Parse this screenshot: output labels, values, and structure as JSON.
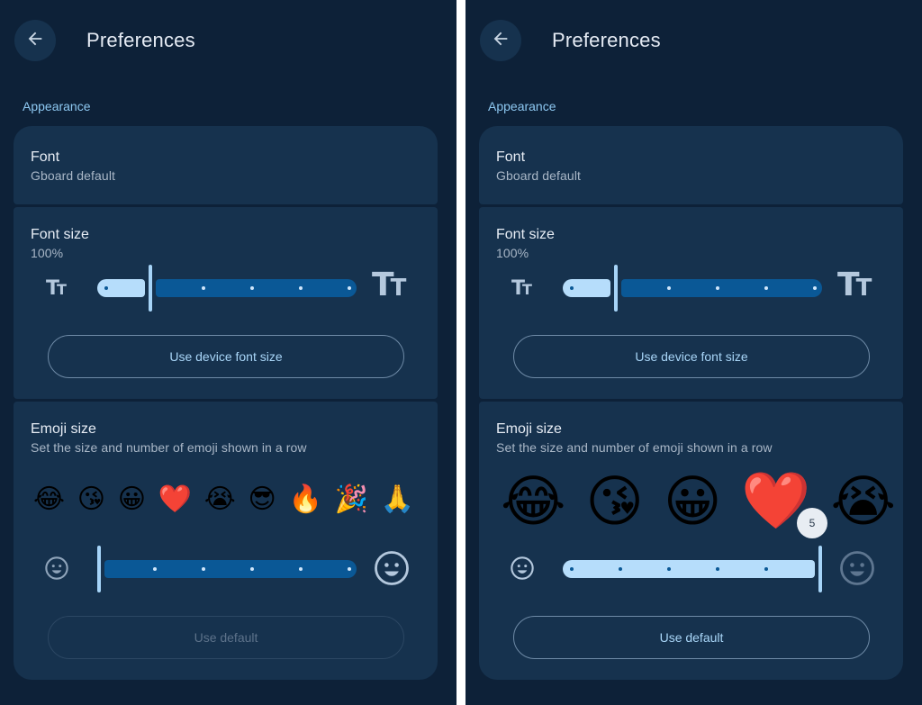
{
  "screens": [
    {
      "title": "Preferences",
      "back_icon": "arrow-left-icon",
      "section_label": "Appearance",
      "font": {
        "title": "Font",
        "value": "Gboard default"
      },
      "font_size": {
        "title": "Font size",
        "value": "100%",
        "slider_level_fraction": 0.2,
        "small_icon": "Tт",
        "big_icon": "Tт",
        "button_label": "Use device font size"
      },
      "emoji_size": {
        "title": "Emoji size",
        "subtitle": "Set the size and number of emoji shown in a row",
        "emojis": [
          "😂",
          "😘",
          "😀",
          "❤️",
          "😭",
          "😎",
          "🔥",
          "🎉",
          "🙏"
        ],
        "slider_level_fraction": 0.0,
        "small_icon": "smiley-small-icon",
        "big_icon": "smiley-large-icon",
        "button_label": "Use default",
        "button_disabled": true
      }
    },
    {
      "title": "Preferences",
      "back_icon": "arrow-left-icon",
      "section_label": "Appearance",
      "font": {
        "title": "Font",
        "value": "Gboard default"
      },
      "font_size": {
        "title": "Font size",
        "value": "100%",
        "slider_level_fraction": 0.2,
        "small_icon": "Tт",
        "big_icon": "Tт",
        "button_label": "Use device font size"
      },
      "emoji_size": {
        "title": "Emoji size",
        "subtitle": "Set the size and number of emoji shown in a row",
        "emojis": [
          "😂",
          "😘",
          "😀",
          "❤️",
          "😭"
        ],
        "slider_level_fraction": 1.0,
        "value_tooltip": "5",
        "small_icon": "smiley-small-icon",
        "big_icon": "smiley-large-icon",
        "button_label": "Use default",
        "button_disabled": false
      }
    }
  ],
  "colors": {
    "background": "#0d2138",
    "card": "#16324e",
    "accent": "#8ec9f2",
    "slider_active": "#b6ddfb",
    "slider_inactive": "#0a5896"
  }
}
